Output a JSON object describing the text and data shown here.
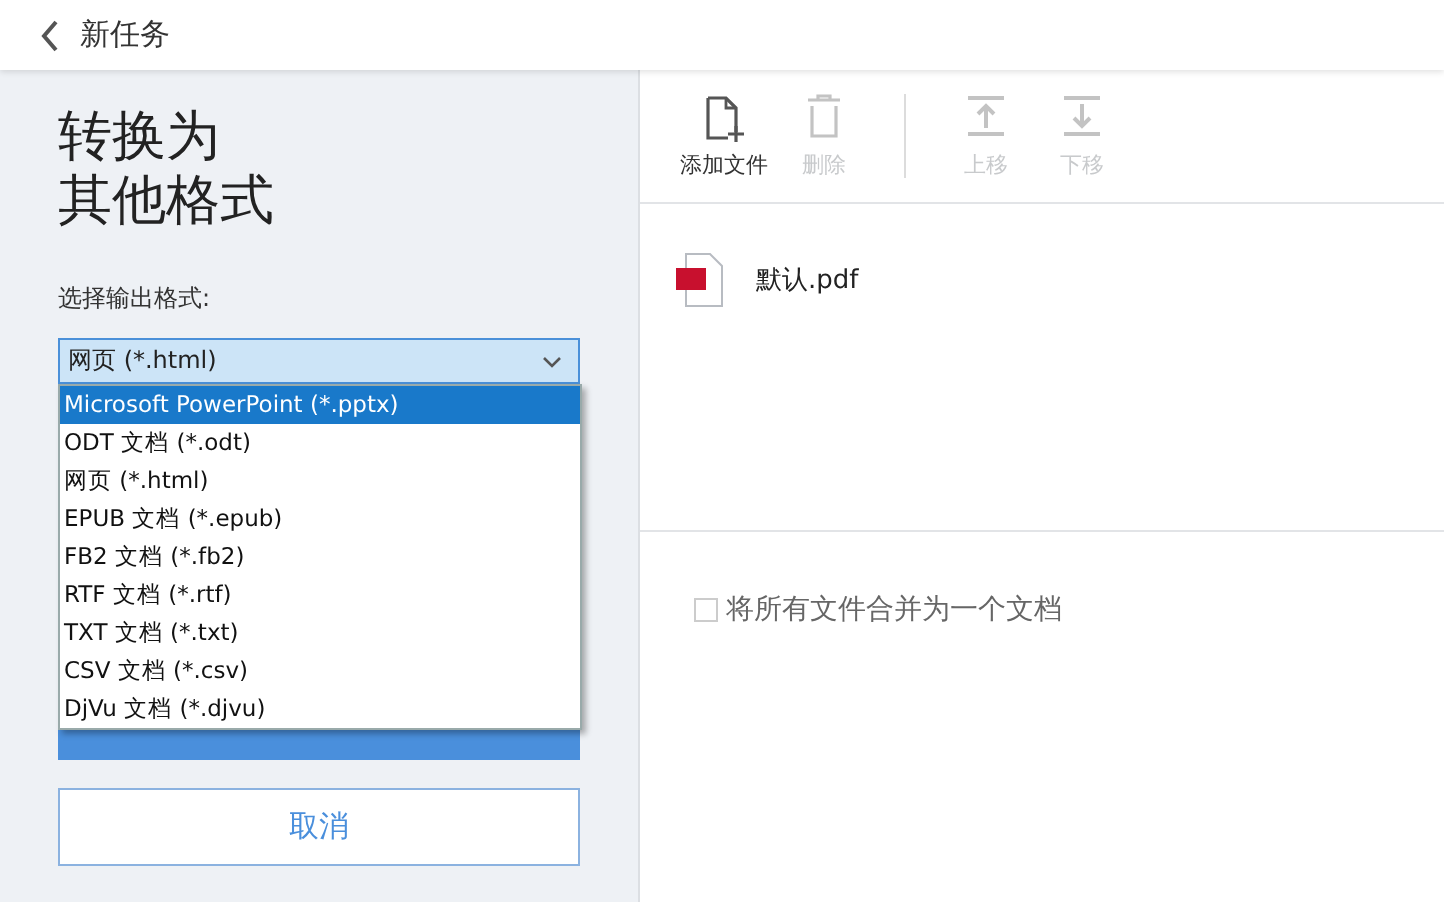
{
  "header": {
    "title": "新任务"
  },
  "left": {
    "heading_lines": [
      "转换为",
      "其他格式"
    ],
    "format_label": "选择输出格式:",
    "format_select": {
      "value": "网页 (*.html)"
    },
    "format_options": [
      {
        "label": "Microsoft PowerPoint (*.pptx)",
        "selected": true
      },
      {
        "label": "ODT 文档 (*.odt)",
        "selected": false
      },
      {
        "label": "网页 (*.html)",
        "selected": false
      },
      {
        "label": "EPUB 文档 (*.epub)",
        "selected": false
      },
      {
        "label": "FB2 文档 (*.fb2)",
        "selected": false
      },
      {
        "label": "RTF 文档 (*.rtf)",
        "selected": false
      },
      {
        "label": "TXT 文档 (*.txt)",
        "selected": false
      },
      {
        "label": "CSV 文档 (*.csv)",
        "selected": false
      },
      {
        "label": "DjVu 文档 (*.djvu)",
        "selected": false
      }
    ],
    "cancel_button": "取消"
  },
  "toolbar": {
    "groups": [
      [
        {
          "kind": "add",
          "label": "添加文件",
          "disabled": false
        },
        {
          "kind": "delete",
          "label": "删除",
          "disabled": true
        }
      ],
      [
        {
          "kind": "up",
          "label": "上移",
          "disabled": true
        },
        {
          "kind": "down",
          "label": "下移",
          "disabled": true
        }
      ]
    ]
  },
  "files": [
    {
      "name": "默认.pdf"
    }
  ],
  "merge_option": {
    "label": "将所有文件合并为一个文档",
    "checked": false
  }
}
